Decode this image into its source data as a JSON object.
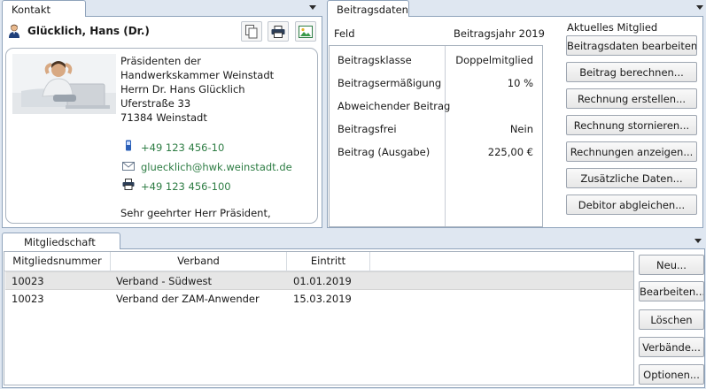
{
  "contact": {
    "tab_label": "Kontakt",
    "name": "Glücklich, Hans (Dr.)",
    "address": [
      "Präsidenten der",
      "Handwerkskammer Weinstadt",
      "Herrn Dr. Hans Glücklich",
      "Uferstraße 33",
      "71384 Weinstadt"
    ],
    "phone": "+49 123 456-10",
    "email": "gluecklich@hwk.weinstadt.de",
    "fax": "+49 123 456-100",
    "salutation": "Sehr geehrter Herr Präsident,"
  },
  "beitragsdaten": {
    "tab_label": "Beitragsdaten",
    "col_field": "Feld",
    "col_year": "Beitragsjahr 2019",
    "rows": [
      {
        "label": "Beitragsklasse",
        "value": "Doppelmitglied"
      },
      {
        "label": "Beitragsermäßigung",
        "value": "10 %"
      },
      {
        "label": "Abweichender Beitrag",
        "value": ""
      },
      {
        "label": "Beitragsfrei",
        "value": "Nein"
      },
      {
        "label": "Beitrag (Ausgabe)",
        "value": "225,00 €"
      }
    ],
    "actions_title": "Aktuelles Mitglied",
    "actions": [
      "Beitragsdaten bearbeiten...",
      "Beitrag berechnen...",
      "Rechnung erstellen...",
      "Rechnung stornieren...",
      "Rechnungen anzeigen...",
      "Zusätzliche Daten...",
      "Debitor abgleichen..."
    ]
  },
  "mitgliedschaft": {
    "tab_label": "Mitgliedschaft",
    "columns": [
      "Mitgliedsnummer",
      "Verband",
      "Eintritt"
    ],
    "rows": [
      [
        "10023",
        "Verband - Südwest",
        "01.01.2019"
      ],
      [
        "10023",
        "Verband der ZAM-Anwender",
        "15.03.2019"
      ]
    ],
    "actions": [
      "Neu...",
      "Bearbeiten...",
      "Löschen",
      "Verbände...",
      "Optionen..."
    ]
  },
  "colors": {
    "accent_green": "#2e7d44",
    "frame": "#8fa3bb",
    "background": "#dfe7f1",
    "selected_row": "#e6e6e6"
  },
  "icons": [
    "person-icon",
    "copy-icon",
    "print-icon",
    "image-icon",
    "phone-icon",
    "mail-icon",
    "fax-icon",
    "chevron-down-icon"
  ]
}
